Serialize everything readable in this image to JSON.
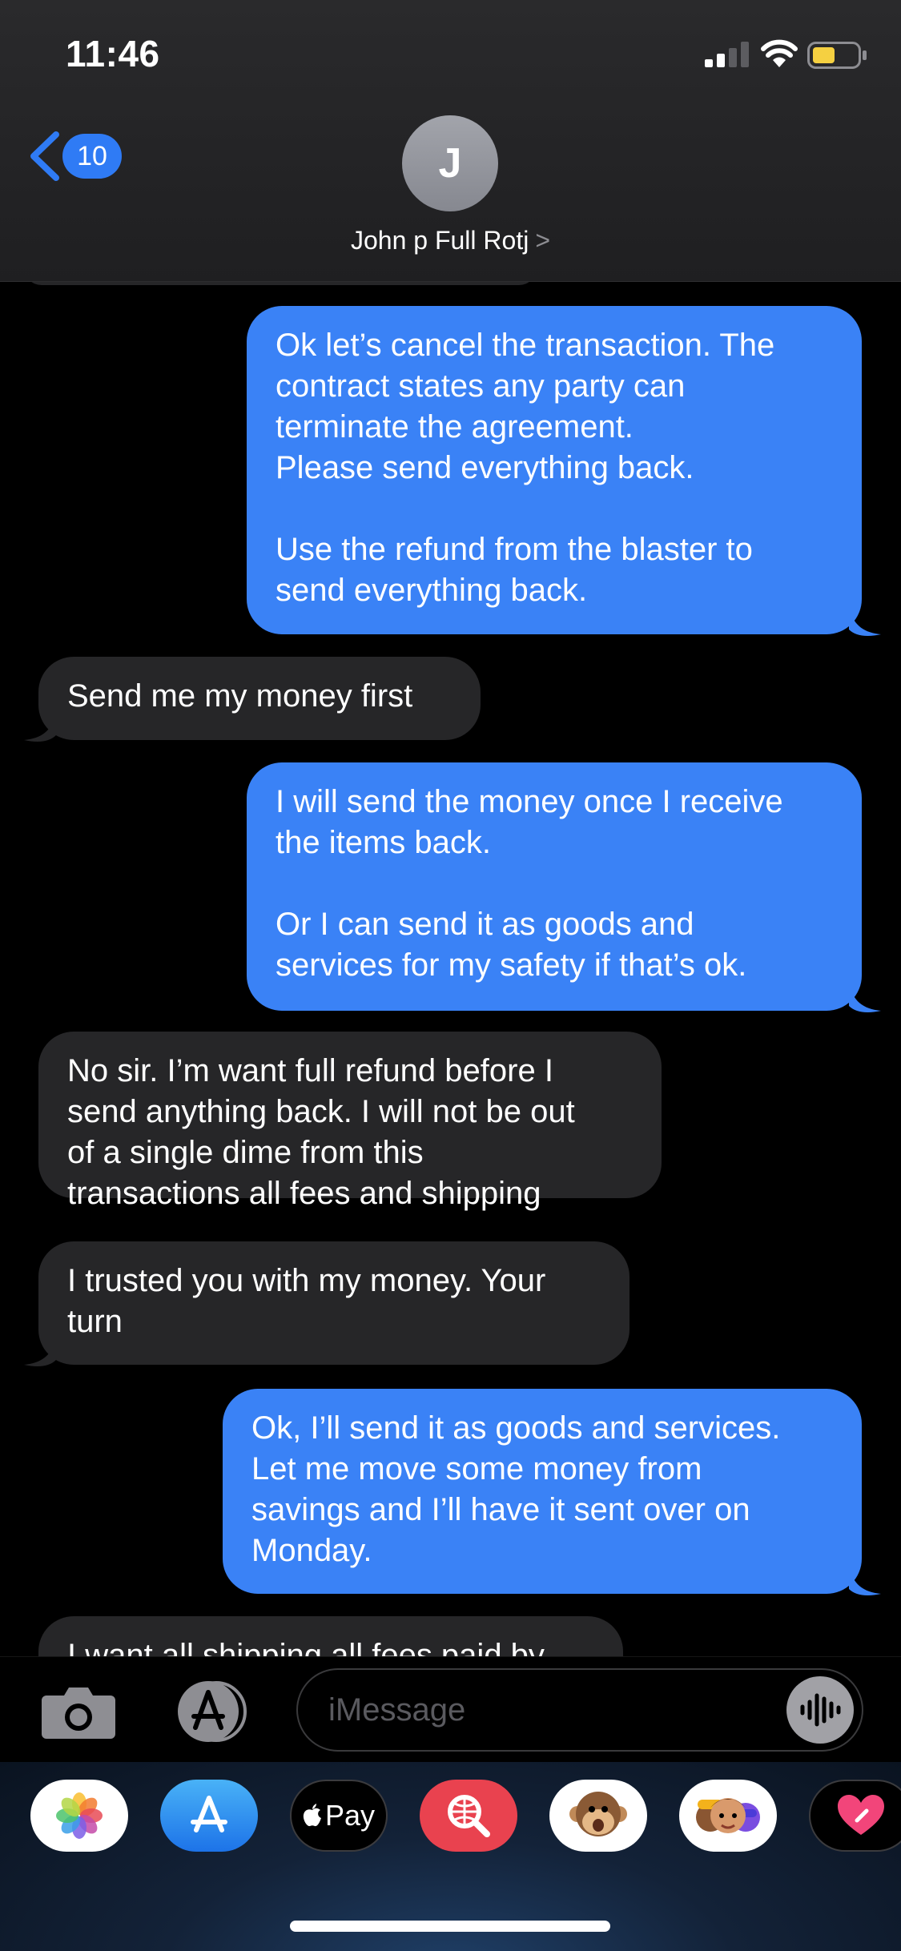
{
  "status_bar": {
    "time": "11:46"
  },
  "header": {
    "back_badge": "10",
    "avatar_initial": "J",
    "contact_name": "John p Full Rotj",
    "chevron": ">"
  },
  "messages": [
    {
      "direction": "sent",
      "text": "Ok let’s cancel the transaction. The\ncontract states any party can\nterminate the agreement.\nPlease send everything back.\n\nUse the refund from the blaster to\nsend everything back."
    },
    {
      "direction": "received",
      "text": "Send me my money first"
    },
    {
      "direction": "sent",
      "text": "I will send the money once I receive\nthe items back.\n\nOr I can send it as goods and\nservices for my safety if that’s ok."
    },
    {
      "direction": "received",
      "text": "No sir. I’m want full refund before I\nsend anything back. I will not be out\nof a single dime from this\ntransactions all fees and shipping"
    },
    {
      "direction": "received",
      "text": "I trusted you with my money. Your\nturn"
    },
    {
      "direction": "sent",
      "text": "Ok, I’ll send it as goods and services.\nLet me move some money from\nsavings and I’ll have it sent over on\nMonday."
    },
    {
      "direction": "received",
      "text": "I want all shipping all fees paid by"
    }
  ],
  "input": {
    "placeholder": "iMessage"
  },
  "app_drawer": {
    "apps": [
      {
        "name": "photos-icon"
      },
      {
        "name": "app-store-icon"
      },
      {
        "name": "apple-pay-icon",
        "label": "Pay"
      },
      {
        "name": "image-search-icon"
      },
      {
        "name": "animoji-monkey-icon"
      },
      {
        "name": "memoji-icon"
      },
      {
        "name": "digital-touch-icon"
      }
    ]
  },
  "colors": {
    "sent_bubble": "#3a82f6",
    "received_bubble": "#262628",
    "accent": "#2f7bf5",
    "battery": "#f5d041"
  }
}
